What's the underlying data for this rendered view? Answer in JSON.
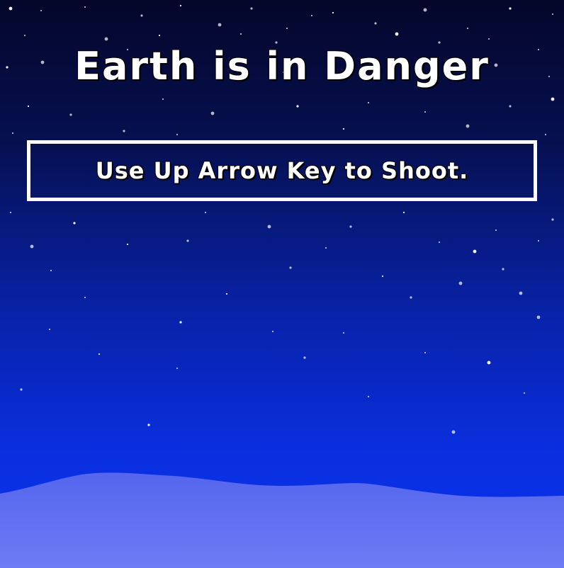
{
  "game": {
    "title": "Earth is in Danger",
    "instruction": "Use Up Arrow Key to Shoot."
  },
  "colors": {
    "sky_top": "#04062a",
    "sky_bottom": "#0b33f0",
    "ground_top": "#5566ee",
    "ground_bottom": "#6c7cf4",
    "text": "#ffffff",
    "box_border": "#ffffff"
  }
}
